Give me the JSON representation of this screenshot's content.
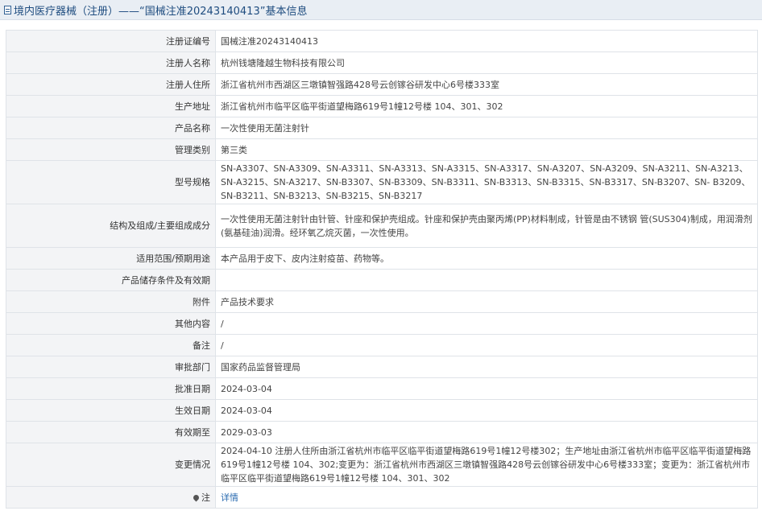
{
  "header": {
    "title": "境内医疗器械（注册）——“国械注准20243140413”基本信息"
  },
  "rows": [
    {
      "label": "注册证编号",
      "value": "国械注准20243140413"
    },
    {
      "label": "注册人名称",
      "value": "杭州钱塘隆越生物科技有限公司"
    },
    {
      "label": "注册人住所",
      "value": "浙江省杭州市西湖区三墩镇智强路428号云创镓谷研发中心6号楼333室"
    },
    {
      "label": "生产地址",
      "value": "浙江省杭州市临平区临平街道望梅路619号1幢12号楼 104、301、302"
    },
    {
      "label": "产品名称",
      "value": "一次性使用无菌注射针"
    },
    {
      "label": "管理类别",
      "value": "第三类"
    },
    {
      "label": "型号规格",
      "value": "SN-A3307、SN-A3309、SN-A3311、SN-A3313、SN-A3315、SN-A3317、SN-A3207、SN-A3209、SN-A3211、SN-A3213、SN-A3215、SN-A3217、SN-B3307、SN-B3309、SN-B3311、SN-B3313、SN-B3315、SN-B3317、SN-B3207、SN- B3209、SN-B3211、SN-B3213、SN-B3215、SN-B3217"
    },
    {
      "label": "结构及组成/主要组成成分",
      "value": "一次性使用无菌注射针由针管、针座和保护壳组成。针座和保护壳由聚丙烯(PP)材料制成，针管是由不锈钢 管(SUS304)制成，用润滑剂(氨基硅油)润滑。经环氧乙烷灭菌，一次性使用。"
    },
    {
      "label": "适用范围/预期用途",
      "value": "本产品用于皮下、皮内注射疫苗、药物等。"
    },
    {
      "label": "产品储存条件及有效期",
      "value": ""
    },
    {
      "label": "附件",
      "value": "产品技术要求"
    },
    {
      "label": "其他内容",
      "value": "/"
    },
    {
      "label": "备注",
      "value": "/"
    },
    {
      "label": "审批部门",
      "value": "国家药品监督管理局"
    },
    {
      "label": "批准日期",
      "value": "2024-03-04"
    },
    {
      "label": "生效日期",
      "value": "2024-03-04"
    },
    {
      "label": "有效期至",
      "value": "2029-03-03"
    },
    {
      "label": "变更情况",
      "value": "2024-04-10 注册人住所由浙江省杭州市临平区临平街道望梅路619号1幢12号楼302；生产地址由浙江省杭州市临平区临平街道望梅路619号1幢12号楼 104、302;变更为：浙江省杭州市西湖区三墩镇智强路428号云创镓谷研发中心6号楼333室；变更为：浙江省杭州市临平区临平街道望梅路619号1幢12号楼 104、301、302"
    }
  ],
  "note_row": {
    "label": "注",
    "link_text": "详情"
  }
}
